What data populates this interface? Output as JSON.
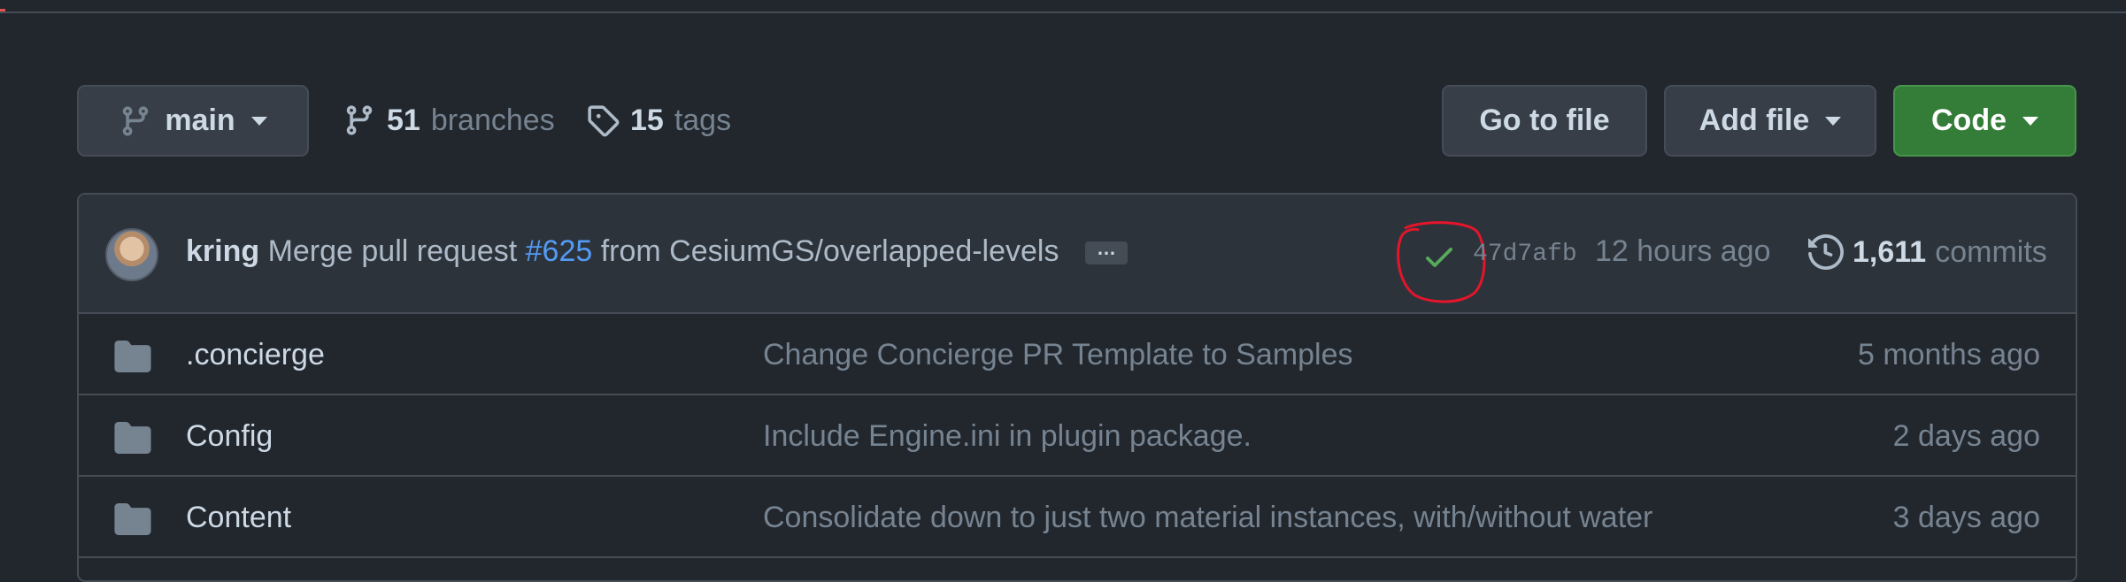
{
  "toolbar": {
    "branch": "main",
    "branches_count": "51",
    "branches_label": "branches",
    "tags_count": "15",
    "tags_label": "tags",
    "goto_file": "Go to file",
    "add_file": "Add file",
    "code": "Code"
  },
  "commit": {
    "author": "kring",
    "message_prefix": "Merge pull request",
    "pr_link": "#625",
    "message_suffix": "from CesiumGS/overlapped-levels",
    "ellipsis": "…",
    "sha": "47d7afb",
    "time": "12 hours ago",
    "commits_count": "1,611",
    "commits_label": "commits",
    "status": "success"
  },
  "files": [
    {
      "name": ".concierge",
      "message": "Change Concierge PR Template to Samples",
      "time": "5 months ago",
      "icon": "folder-icon"
    },
    {
      "name": "Config",
      "message": "Include Engine.ini in plugin package.",
      "time": "2 days ago",
      "icon": "folder-icon"
    },
    {
      "name": "Content",
      "message": "Consolidate down to just two material instances, with/without water",
      "time": "3 days ago",
      "icon": "folder-icon"
    }
  ],
  "colors": {
    "background": "#22272e",
    "header_bg": "#2d333b",
    "code_button": "#347d39",
    "link": "#539bf5",
    "check": "#57ab5a",
    "annotation": "#e5152b"
  }
}
